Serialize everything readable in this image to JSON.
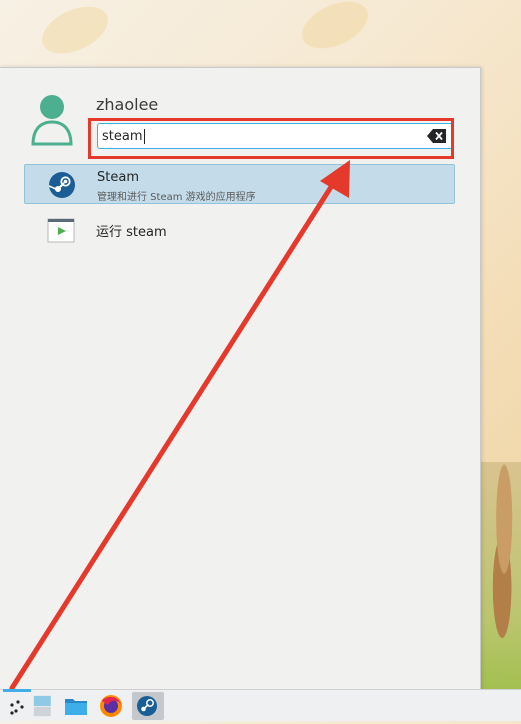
{
  "user": {
    "name": "zhaolee"
  },
  "search": {
    "query": "steam"
  },
  "results": [
    {
      "title": "Steam",
      "subtitle": "管理和进行 Steam 游戏的应用程序",
      "icon": "steam-icon",
      "selected": true
    },
    {
      "title": "运行 steam",
      "icon": "run-command-icon",
      "selected": false
    }
  ],
  "taskbar": {
    "items": [
      "application-launcher-icon",
      "pager-icon",
      "file-manager-icon",
      "firefox-icon",
      "steam-icon"
    ]
  },
  "colors": {
    "accent": "#3daee9",
    "selection": "#c4dcea",
    "annotation": "#e5392b",
    "avatar": "#4caf8f"
  }
}
